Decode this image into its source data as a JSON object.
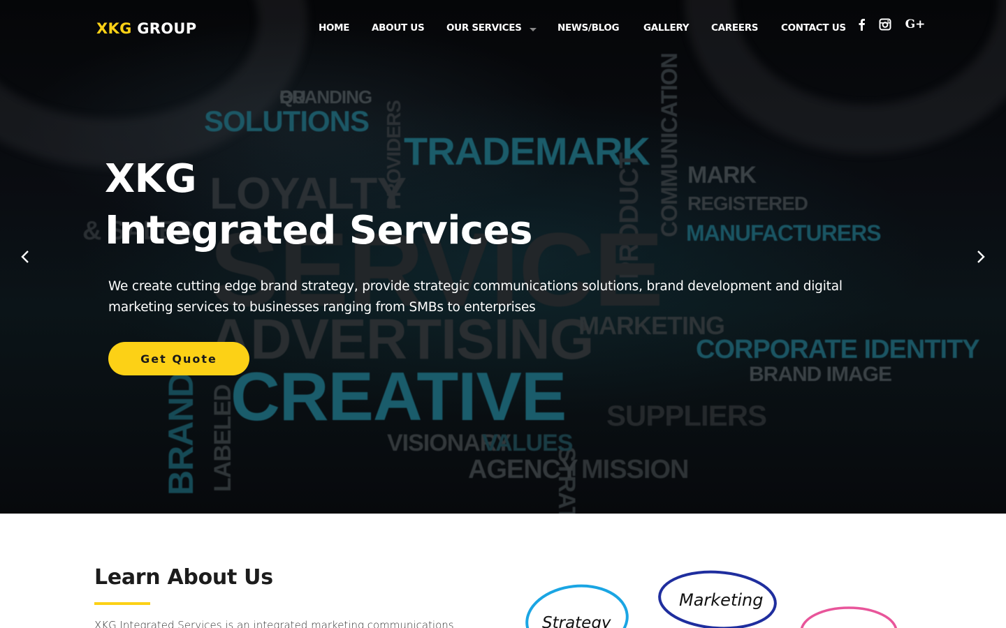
{
  "brand": {
    "name_accent": "XKG",
    "name_rest": "GROUP"
  },
  "nav": {
    "items": [
      {
        "label": "HOME"
      },
      {
        "label": "ABOUT US"
      },
      {
        "label": "OUR SERVICES"
      },
      {
        "label": "NEWS/BLOG"
      },
      {
        "label": "GALLERY"
      },
      {
        "label": "CAREERS"
      },
      {
        "label": "CONTACT US"
      }
    ],
    "social": [
      "facebook-icon",
      "instagram-icon",
      "google-plus-icon"
    ],
    "google_plus_label": "G+"
  },
  "hero": {
    "title_line1": "XKG",
    "title_line2": "Integrated Services",
    "subtitle": "We create cutting edge brand strategy, provide strategic communications solutions, brand development and digital marketing services to businesses ranging from SMBs to enterprises",
    "cta_label": "Get Quote",
    "background_words": [
      "BRANDING",
      "SOLUTIONS",
      "PROVIDERS",
      "TRADEMARK",
      "COMMUNICATION",
      "MARK",
      "REGISTERED",
      "LOYALTY",
      "MANUFACTURERS",
      "PRODUCT",
      "SERVICE",
      "BRAND",
      "ADVERTISING",
      "MARKETING",
      "CORPORATE IDENTITY",
      "BRAND IMAGE",
      "LABELED",
      "CREATIVE",
      "STRATEGY",
      "SUPPLIERS",
      "VISIONARY",
      "VALUES",
      "AGENCY",
      "MISSION",
      "& SALES",
      "QU"
    ]
  },
  "about": {
    "title": "Learn About Us",
    "text": "XKG Integrated Services is an integrated marketing communications",
    "bubbles": [
      "Strategy",
      "Marketing"
    ]
  },
  "colors": {
    "accent": "#fcd116",
    "hero_bg": "#07090c",
    "white": "#ffffff"
  }
}
